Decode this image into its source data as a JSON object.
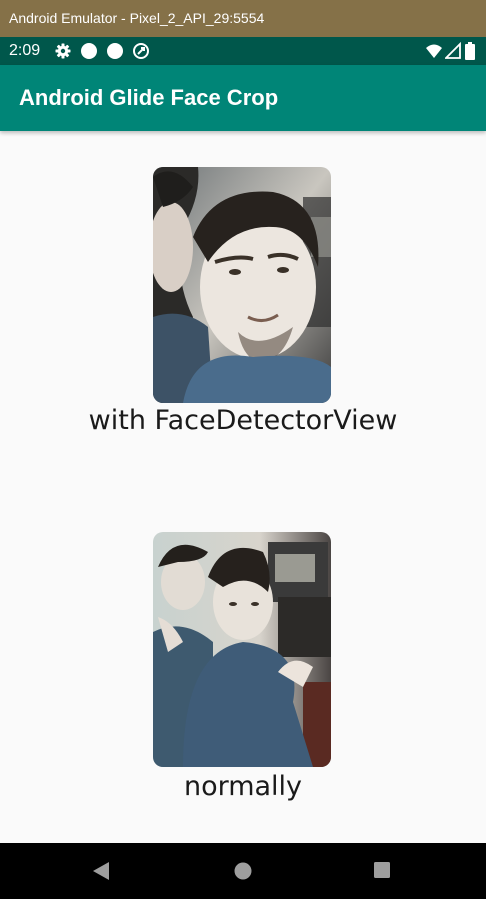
{
  "window": {
    "title": "Android Emulator - Pixel_2_API_29:5554"
  },
  "status_bar": {
    "time": "2:09",
    "icons": [
      "settings-icon",
      "notification-dot-icon",
      "notification-dot-icon",
      "sync-icon",
      "wifi-icon",
      "signal-icon",
      "battery-icon"
    ]
  },
  "app_bar": {
    "title": "Android Glide Face Crop",
    "color": "#008577"
  },
  "images": [
    {
      "caption": "with FaceDetectorView"
    },
    {
      "caption": "normally"
    }
  ],
  "nav_bar": {
    "icons": [
      "back-icon",
      "home-icon",
      "recents-icon"
    ]
  }
}
